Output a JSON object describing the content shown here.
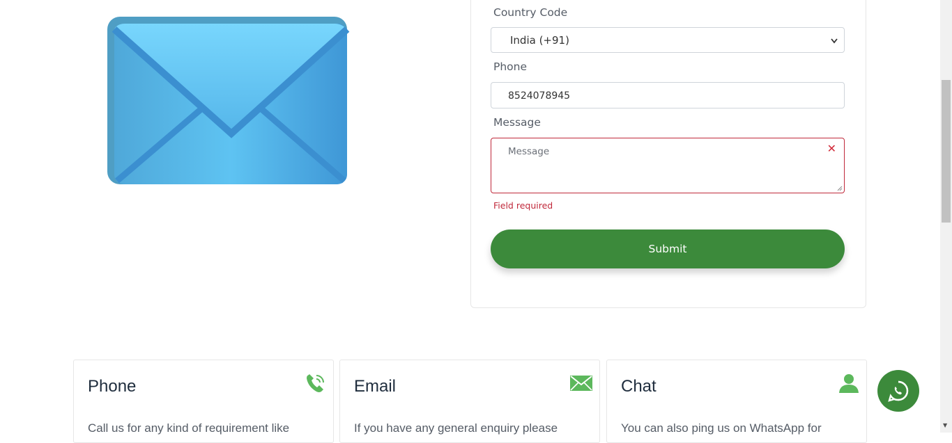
{
  "form": {
    "country_code_label": "Country Code",
    "country_code_value": "India (+91)",
    "phone_label": "Phone",
    "phone_value": "8524078945",
    "message_label": "Message",
    "message_placeholder": "Message",
    "message_error": "Field required",
    "submit_label": "Submit"
  },
  "cards": [
    {
      "title": "Phone",
      "description": "Call us for any kind of requirement like",
      "icon": "phone-icon"
    },
    {
      "title": "Email",
      "description": "If you have any general enquiry please",
      "icon": "email-icon"
    },
    {
      "title": "Chat",
      "description": "You can also ping us on WhatsApp for",
      "icon": "user-icon"
    }
  ],
  "colors": {
    "brand_green": "#3c8a3b",
    "error_red": "#c0283a",
    "icon_green": "#5cb85c",
    "envelope_blue": "#55b6ea"
  },
  "icons": {
    "hero": "envelope-icon",
    "floating": "whatsapp-icon"
  }
}
